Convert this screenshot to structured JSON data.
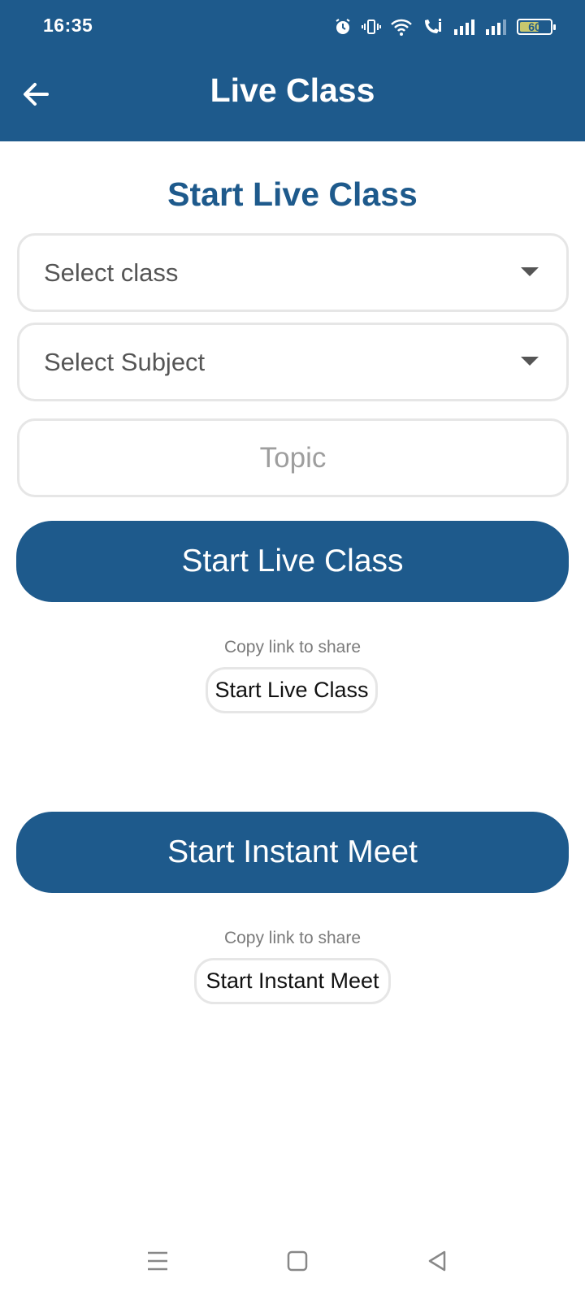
{
  "status_bar": {
    "time": "16:35",
    "battery_level": "60",
    "icons": [
      "alarm-icon",
      "vibrate-icon",
      "wifi-icon",
      "wifi-calling-icon",
      "signal-icon",
      "signal-icon",
      "battery-icon"
    ]
  },
  "app_bar": {
    "title": "Live Class",
    "back_icon": "arrow-left-icon"
  },
  "live_class": {
    "title": "Start Live Class",
    "class_select": {
      "value": "Select class"
    },
    "subject_select": {
      "value": "Select Subject"
    },
    "topic_input": {
      "placeholder": "Topic",
      "value": ""
    },
    "start_button_label": "Start Live Class",
    "copy_label": "Copy link to share",
    "copy_link_chip": "Start Live Class"
  },
  "instant_meet": {
    "start_button_label": "Start Instant Meet",
    "copy_label": "Copy link to share",
    "copy_link_chip": "Start Instant Meet"
  },
  "nav_bar": {
    "icons": [
      "menu-icon",
      "home-square-icon",
      "back-triangle-icon"
    ]
  },
  "colors": {
    "primary": "#1e5a8c",
    "field_border": "#e6e6e6",
    "muted_text": "#7a7a7a"
  }
}
